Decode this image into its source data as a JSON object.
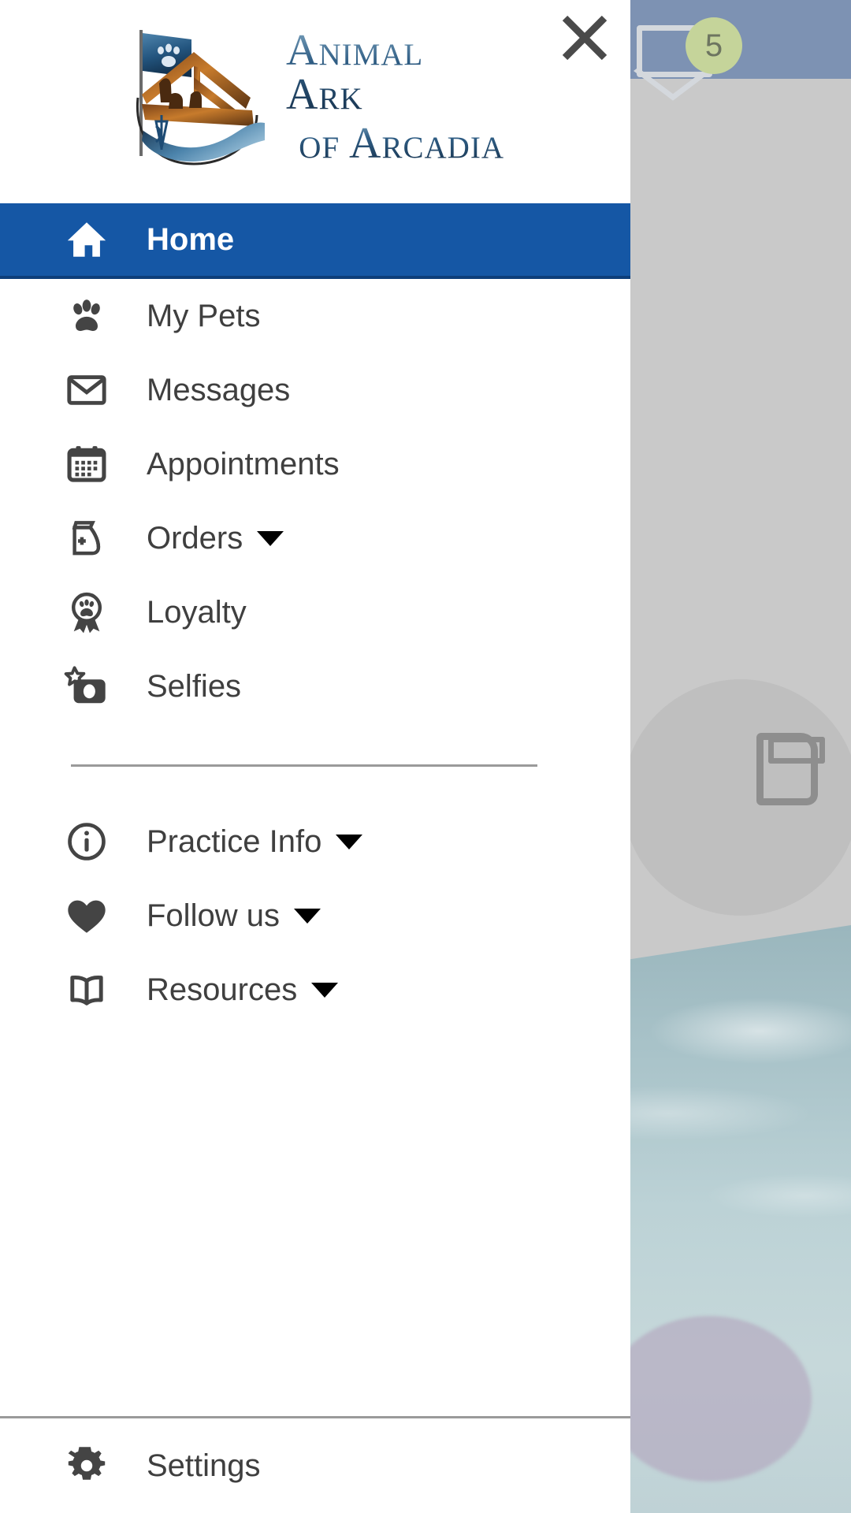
{
  "brand": {
    "logo_icon": "ark-boat-logo",
    "name_line1": "Animal Ark",
    "name_line2": "of Arcadia"
  },
  "drawer": {
    "close_icon": "close-x-icon",
    "close_label": "Close",
    "primary_items": [
      {
        "id": "home",
        "label": "Home",
        "icon": "home-icon",
        "active": true,
        "expandable": false
      },
      {
        "id": "my-pets",
        "label": "My Pets",
        "icon": "paw-print-icon",
        "active": false,
        "expandable": false
      },
      {
        "id": "messages",
        "label": "Messages",
        "icon": "envelope-icon",
        "active": false,
        "expandable": false
      },
      {
        "id": "appointments",
        "label": "Appointments",
        "icon": "calendar-icon",
        "active": false,
        "expandable": false
      },
      {
        "id": "orders",
        "label": "Orders",
        "icon": "food-bag-icon",
        "active": false,
        "expandable": true
      },
      {
        "id": "loyalty",
        "label": "Loyalty",
        "icon": "award-paw-icon",
        "active": false,
        "expandable": false
      },
      {
        "id": "selfies",
        "label": "Selfies",
        "icon": "camera-star-icon",
        "active": false,
        "expandable": false
      }
    ],
    "secondary_items": [
      {
        "id": "practice-info",
        "label": "Practice Info",
        "icon": "info-circle-icon",
        "active": false,
        "expandable": true
      },
      {
        "id": "follow-us",
        "label": "Follow us",
        "icon": "heart-icon",
        "active": false,
        "expandable": true
      },
      {
        "id": "resources",
        "label": "Resources",
        "icon": "open-book-icon",
        "active": false,
        "expandable": true
      }
    ],
    "footer_items": [
      {
        "id": "settings",
        "label": "Settings",
        "icon": "gear-icon",
        "active": false,
        "expandable": false
      }
    ]
  },
  "background": {
    "topbar_color": "#7d92b3",
    "mail_icon": "envelope-icon",
    "mail_badge_count": "5",
    "mail_badge_color": "#c5d49a",
    "card_icon": "food-bag-icon",
    "photo": "water-surface-photo"
  },
  "colors": {
    "active_item_bg": "#1557a5",
    "active_item_shadow": "#0d3e7a",
    "icon_gray": "#444444",
    "text_gray": "#3f3f3f",
    "divider_gray": "#9a9a9a"
  }
}
